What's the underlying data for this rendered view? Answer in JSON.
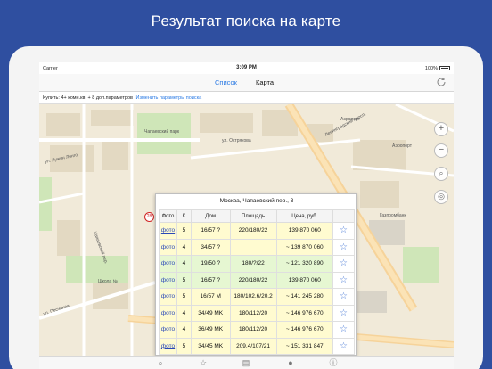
{
  "promo": {
    "title": "Результат поиска на карте"
  },
  "statusbar": {
    "carrier": "Carrier",
    "time": "3:09 PM",
    "battery": "100%"
  },
  "navbar": {
    "tab_list": "Список",
    "tab_map": "Карта"
  },
  "filter": {
    "text": "Купить: 4+ комн.кв. + 8 доп.параметров",
    "link": "Изменить параметры поиска"
  },
  "map": {
    "labels": {
      "chapaevsky_park": "Чапаевский парк",
      "ostryakova": "ул. Острякова",
      "leningradsky": "Ленинградский просп.",
      "aeroport_top": "Аэропорт",
      "aeroport_right": "Аэропорт",
      "luzhin": "ул. Лужин Лонго",
      "chapaevsky_per": "Чапаевский пер.",
      "peschanaya": "ул. Песчаная",
      "shkola": "Школа №",
      "gazprom": "Газпромбанк"
    }
  },
  "popup": {
    "address": "Москва, Чапаевский пер., 3",
    "headers": [
      "Фото",
      "К",
      "Дом",
      "Площадь",
      "Цена, руб.",
      ""
    ],
    "rows": [
      {
        "photo": "фото",
        "rooms": "5",
        "house": "16/57 ?",
        "area": "220/180/22",
        "price": "139 870 060",
        "color": "yellow"
      },
      {
        "photo": "фото",
        "rooms": "4",
        "house": "34/57 ?",
        "area": "",
        "price": "~ 139 870 060",
        "color": "yellow"
      },
      {
        "photo": "фото",
        "rooms": "4",
        "house": "19/50 ?",
        "area": "180/?/22",
        "price": "~ 121 320 890",
        "color": "green"
      },
      {
        "photo": "фото",
        "rooms": "5",
        "house": "16/57 ?",
        "area": "220/180/22",
        "price": "139 870 060",
        "color": "green"
      },
      {
        "photo": "фото",
        "rooms": "5",
        "house": "16/57 M",
        "area": "180/102.6/20.2",
        "price": "~ 141 245 280",
        "color": "yellow"
      },
      {
        "photo": "фото",
        "rooms": "4",
        "house": "34/49 MK",
        "area": "180/112/20",
        "price": "~ 146 976 670",
        "color": "yellow"
      },
      {
        "photo": "фото",
        "rooms": "4",
        "house": "36/49 MK",
        "area": "180/112/20",
        "price": "~ 146 976 670",
        "color": "yellow"
      },
      {
        "photo": "фото",
        "rooms": "5",
        "house": "34/45 MK",
        "area": "209.4/107/21",
        "price": "~ 151 331 847",
        "color": "yellow"
      }
    ],
    "star_icon": "star-outline-icon"
  },
  "marker": {
    "count": "28"
  },
  "tabs": [
    "search-icon",
    "star-icon",
    "clipboard-icon",
    "user-icon",
    "info-icon"
  ],
  "colors": {
    "accent": "#2a7ae4",
    "promo_bg": "#2f4fa0",
    "row_yellow": "#fffbd0",
    "row_green": "#e6f7d2"
  }
}
